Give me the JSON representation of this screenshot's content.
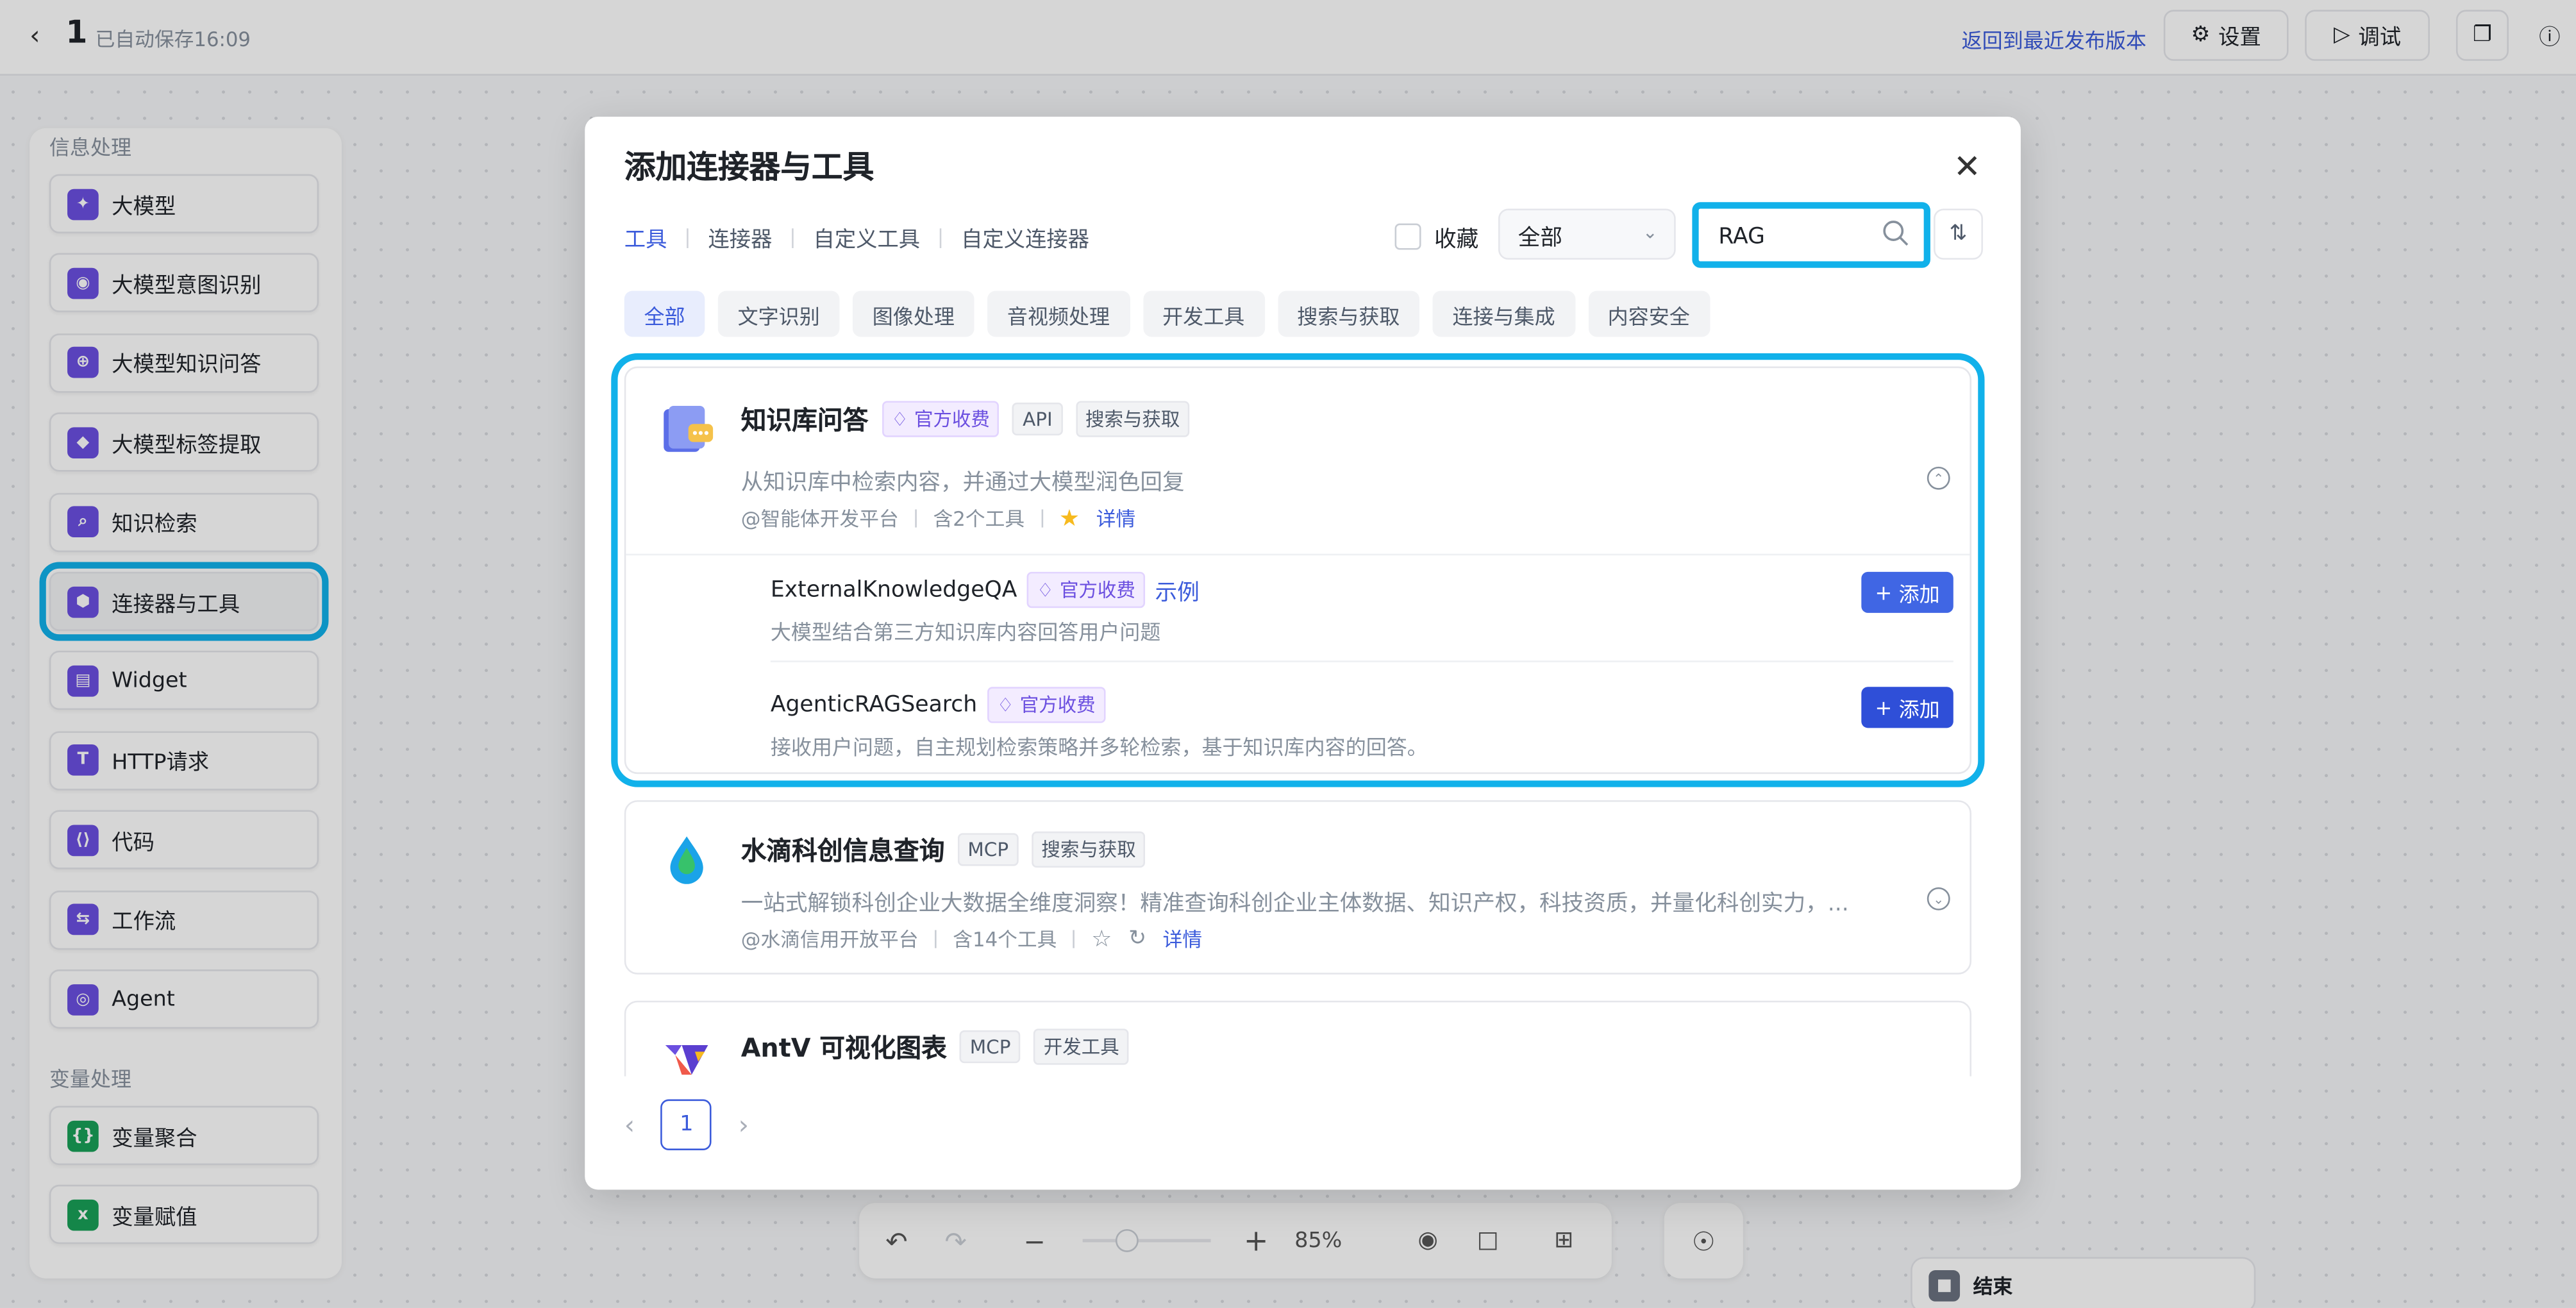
{
  "topbar": {
    "back_icon": "chevron-left-icon",
    "title": "1",
    "saved_text": "已自动保存16:09",
    "restore_link": "返回到最近发布版本",
    "settings_label": "设置",
    "debug_label": "调试"
  },
  "left_panel": {
    "section_info": "信息处理",
    "items": [
      {
        "label": "大模型",
        "icon": "sparkle-icon"
      },
      {
        "label": "大模型意图识别",
        "icon": "eye-icon"
      },
      {
        "label": "大模型知识问答",
        "icon": "plus-circle-icon"
      },
      {
        "label": "大模型标签提取",
        "icon": "tag-icon"
      },
      {
        "label": "知识检索",
        "icon": "search-icon"
      },
      {
        "label": "连接器与工具",
        "icon": "cube-icon"
      },
      {
        "label": "Widget",
        "icon": "widget-icon"
      },
      {
        "label": "HTTP请求",
        "icon": "http-icon"
      },
      {
        "label": "代码",
        "icon": "code-icon"
      },
      {
        "label": "工作流",
        "icon": "workflow-icon"
      },
      {
        "label": "Agent",
        "icon": "agent-icon"
      }
    ],
    "section_var": "变量处理",
    "var_items": [
      {
        "label": "变量聚合",
        "icon": "brackets-icon"
      },
      {
        "label": "变量赋值",
        "icon": "assign-icon"
      }
    ]
  },
  "bottombar": {
    "zoom": "85%"
  },
  "end_node": {
    "label": "结束"
  },
  "modal": {
    "title": "添加连接器与工具",
    "tabs": [
      "工具",
      "连接器",
      "自定义工具",
      "自定义连接器"
    ],
    "favorite_label": "收藏",
    "filter_value": "全部",
    "search_value": "RAG",
    "categories": [
      "全部",
      "文字识别",
      "图像处理",
      "音视频处理",
      "开发工具",
      "搜索与获取",
      "连接与集成",
      "内容安全"
    ],
    "cards": [
      {
        "name": "知识库问答",
        "tags": [
          "官方收费",
          "API",
          "搜索与获取"
        ],
        "desc": "从知识库中检索内容，并通过大模型润色回复",
        "platform": "@智能体开发平台",
        "count": "含2个工具",
        "detail": "详情",
        "subtools": [
          {
            "name": "ExternalKnowledgeQA",
            "tag": "官方收费",
            "example": "示例",
            "desc": "大模型结合第三方知识库内容回答用户问题",
            "add": "添加"
          },
          {
            "name": "AgenticRAGSearch",
            "tag": "官方收费",
            "desc": "接收用户问题，自主规划检索策略并多轮检索，基于知识库内容的回答。",
            "add": "添加"
          }
        ]
      },
      {
        "name": "水滴科创信息查询",
        "tags": [
          "MCP",
          "搜索与获取"
        ],
        "desc": "一站式解锁科创企业大数据全维度洞察！精准查询科创企业主体数据、知识产权，科技资质，并量化科创实力，...",
        "platform": "@水滴信用开放平台",
        "count": "含14个工具",
        "detail": "详情"
      },
      {
        "name": "AntV 可视化图表",
        "tags": [
          "MCP",
          "开发工具"
        ]
      }
    ],
    "page": "1"
  },
  "colors": {
    "accent": "#3b5bdb",
    "highlight": "#11b1ea",
    "purple": "#6b4fe0"
  }
}
